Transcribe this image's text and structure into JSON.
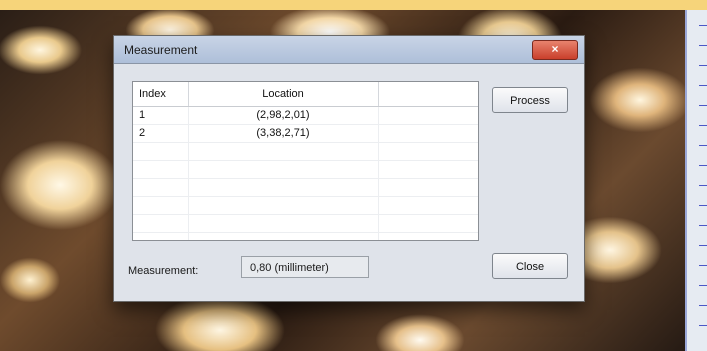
{
  "dialog": {
    "title": "Measurement",
    "close_icon": "close-icon",
    "table": {
      "columns": [
        "Index",
        "Location",
        ""
      ],
      "rows": [
        {
          "index": "1",
          "location": "(2,98,2,01)"
        },
        {
          "index": "2",
          "location": "(3,38,2,71)"
        }
      ]
    },
    "process_label": "Process",
    "close_label": "Close",
    "measurement_label": "Measurement:",
    "measurement_value": "0,80 (millimeter)"
  },
  "theme": {
    "close_button_color": "#c93f2b",
    "ruler_tick_color": "#4b57c7"
  }
}
